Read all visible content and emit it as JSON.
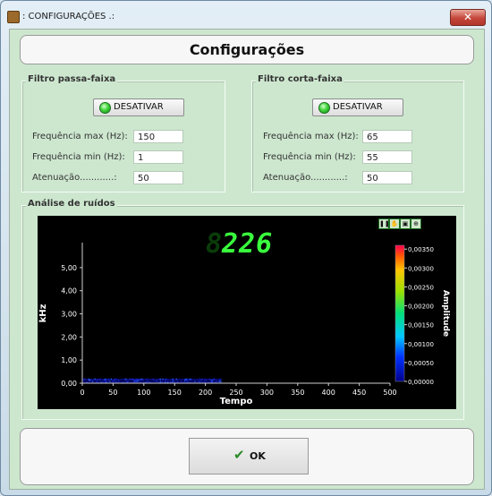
{
  "window": {
    "title": ": CONFIGURAÇÕES .:",
    "close_glyph": "✕"
  },
  "header": {
    "title": "Configurações"
  },
  "bandpass": {
    "legend": "Filtro passa-faixa",
    "toggle_label": "DESATIVAR",
    "fields": [
      {
        "label": "Frequência max (Hz):",
        "value": "150"
      },
      {
        "label": "Frequência min (Hz):",
        "value": "1"
      },
      {
        "label": "Atenuação............:",
        "value": "50"
      }
    ]
  },
  "bandstop": {
    "legend": "Filtro corta-faixa",
    "toggle_label": "DESATIVAR",
    "fields": [
      {
        "label": "Frequência max (Hz):",
        "value": "65"
      },
      {
        "label": "Frequência min (Hz):",
        "value": "55"
      },
      {
        "label": "Atenuação............:",
        "value": "50"
      }
    ]
  },
  "noise": {
    "legend": "Análise de ruídos"
  },
  "chart_data": {
    "type": "heatmap",
    "readout": "226",
    "readout_ghost": "8",
    "xlabel": "Tempo",
    "ylabel": "kHz",
    "colorbar_label": "Amplitude",
    "x_ticks": [
      "0",
      "50",
      "100",
      "150",
      "200",
      "250",
      "300",
      "350",
      "400",
      "450",
      "500"
    ],
    "y_ticks": [
      "0,00",
      "1,00",
      "2,00",
      "3,00",
      "4,00",
      "5,00"
    ],
    "colorbar_ticks": [
      "0,00000",
      "0,00050",
      "0,00100",
      "0,00150",
      "0,00200",
      "0,00250",
      "0,00300",
      "0,00350"
    ],
    "xlim": [
      0,
      500
    ],
    "ylim": [
      0,
      5.5
    ],
    "clim": [
      0,
      0.0036
    ],
    "data_extent": {
      "x": [
        0,
        226
      ],
      "y": [
        0,
        0.2
      ]
    },
    "toolbar_icons": [
      "pause-icon",
      "hand-icon",
      "save-icon",
      "zoom-icon"
    ]
  },
  "footer": {
    "ok_label": "OK",
    "ok_icon": "check-icon"
  }
}
